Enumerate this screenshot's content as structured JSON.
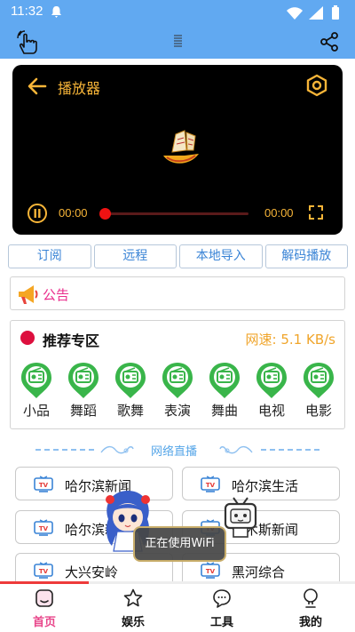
{
  "status_bar": {
    "time": "11:32"
  },
  "player": {
    "title": "播放器",
    "current_time": "00:00",
    "total_time": "00:00",
    "progress": 0.0,
    "accent_color": "#f7b538"
  },
  "tabs": [
    "订阅",
    "远程",
    "本地导入",
    "解码播放"
  ],
  "notice": {
    "label": "公告"
  },
  "recommend": {
    "title": "推荐专区",
    "speed": "网速: 5.1 KB/s",
    "categories": [
      "小品",
      "舞蹈",
      "歌舞",
      "表演",
      "舞曲",
      "电视",
      "电影"
    ]
  },
  "live": {
    "title": "网络直播"
  },
  "channels": [
    "哈尔滨新闻",
    "哈尔滨生活",
    "哈尔滨新",
    "佳木斯新闻",
    "大兴安岭",
    "黑河综合"
  ],
  "toast": {
    "text": "正在使用WiFi"
  },
  "bottom_nav": {
    "items": [
      "首页",
      "娱乐",
      "工具",
      "我的"
    ],
    "active_index": 0,
    "active_color": "#e8458a"
  }
}
